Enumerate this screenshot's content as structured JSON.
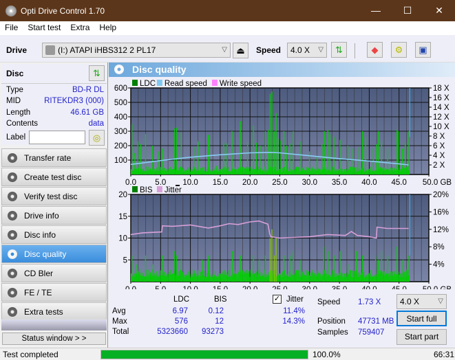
{
  "window": {
    "title": "Opti Drive Control 1.70",
    "minimize": "—",
    "maximize": "☐",
    "close": "✕"
  },
  "menu": [
    "File",
    "Start test",
    "Extra",
    "Help"
  ],
  "toolbar": {
    "drive_label": "Drive",
    "drive_value": "(I:)  ATAPI iHBS312   2 PL17",
    "speed_label": "Speed",
    "speed_value": "4.0 X",
    "eject": "⏏"
  },
  "disc": {
    "title": "Disc",
    "rows": [
      {
        "k": "Type",
        "v": "BD-R DL"
      },
      {
        "k": "MID",
        "v": "RITEKDR3 (000)"
      },
      {
        "k": "Length",
        "v": "46.61 GB"
      },
      {
        "k": "Contents",
        "v": "data"
      }
    ],
    "label_key": "Label",
    "label_value": ""
  },
  "nav": [
    "Transfer rate",
    "Create test disc",
    "Verify test disc",
    "Drive info",
    "Disc info",
    "Disc quality",
    "CD Bler",
    "FE / TE",
    "Extra tests"
  ],
  "nav_active": 5,
  "status_window": "Status window > >",
  "panel_title": "Disc quality",
  "chart_data": [
    {
      "type": "bar",
      "title": "",
      "legend": [
        "LDC",
        "Read speed",
        "Write speed"
      ],
      "colors": {
        "LDC": "#00c000",
        "Read speed": "#80c8f0",
        "Write speed": "#ff80ff"
      },
      "xlabel": "GB",
      "xlim": [
        0,
        50
      ],
      "xticks": [
        "0.0",
        "5.0",
        "10.0",
        "15.0",
        "20.0",
        "25.0",
        "30.0",
        "35.0",
        "40.0",
        "45.0",
        "50.0 GB"
      ],
      "ylim": [
        0,
        600
      ],
      "yticks": [
        "100",
        "200",
        "300",
        "400",
        "500",
        "600"
      ],
      "y2lim": [
        0,
        18
      ],
      "y2ticks": [
        "2 X",
        "4 X",
        "6 X",
        "8 X",
        "10 X",
        "12 X",
        "14 X",
        "16 X",
        "18 X"
      ],
      "ldc_peaks": [
        [
          0.1,
          350
        ],
        [
          0.6,
          150
        ],
        [
          1.1,
          230
        ],
        [
          1.6,
          210
        ],
        [
          2.4,
          280
        ],
        [
          3.6,
          200
        ],
        [
          4.5,
          160
        ],
        [
          5.3,
          180
        ],
        [
          7.3,
          320
        ],
        [
          7.6,
          325
        ],
        [
          8.4,
          290
        ],
        [
          10.5,
          190
        ],
        [
          11.2,
          230
        ],
        [
          12.9,
          275
        ],
        [
          13.1,
          270
        ],
        [
          14.3,
          60
        ],
        [
          15.5,
          220
        ],
        [
          16.1,
          215
        ],
        [
          16.9,
          300
        ],
        [
          18.3,
          370
        ],
        [
          19.5,
          225
        ],
        [
          20.5,
          340
        ],
        [
          21.0,
          220
        ],
        [
          21.6,
          200
        ],
        [
          22.5,
          300
        ],
        [
          23.0,
          310
        ],
        [
          23.3,
          560
        ],
        [
          23.6,
          575
        ],
        [
          24.0,
          300
        ],
        [
          24.3,
          425
        ],
        [
          24.6,
          250
        ],
        [
          25.1,
          235
        ],
        [
          25.6,
          300
        ],
        [
          26.1,
          200
        ],
        [
          26.6,
          215
        ],
        [
          27.2,
          300
        ],
        [
          28.5,
          230
        ],
        [
          29.9,
          160
        ],
        [
          31.2,
          120
        ],
        [
          32.0,
          210
        ],
        [
          32.4,
          300
        ],
        [
          33.0,
          310
        ],
        [
          33.3,
          280
        ],
        [
          34.0,
          260
        ],
        [
          35.0,
          240
        ],
        [
          36.3,
          200
        ],
        [
          37.0,
          180
        ],
        [
          38.0,
          190
        ],
        [
          38.8,
          300
        ],
        [
          39.3,
          260
        ],
        [
          40.6,
          180
        ],
        [
          41.2,
          210
        ],
        [
          41.5,
          300
        ],
        [
          42.0,
          230
        ],
        [
          43.0,
          180
        ],
        [
          44.6,
          310
        ],
        [
          44.8,
          300
        ],
        [
          45.5,
          180
        ],
        [
          46.0,
          220
        ],
        [
          46.6,
          300
        ]
      ],
      "read_speed": [
        [
          0,
          2.1
        ],
        [
          2,
          2.4
        ],
        [
          5,
          2.9
        ],
        [
          10,
          3.6
        ],
        [
          15,
          4.1
        ],
        [
          20,
          4.5
        ],
        [
          23.5,
          4.6
        ],
        [
          25,
          4.5
        ],
        [
          30,
          3.9
        ],
        [
          35,
          3.3
        ],
        [
          40,
          2.8
        ],
        [
          45,
          2.2
        ],
        [
          46.6,
          2.0
        ]
      ]
    },
    {
      "type": "bar",
      "title": "",
      "legend": [
        "BIS",
        "Jitter"
      ],
      "colors": {
        "BIS": "#00c000",
        "Jitter": "#d8a0d8"
      },
      "xlabel": "GB",
      "xlim": [
        0,
        50
      ],
      "xticks": [
        "0.0",
        "5.0",
        "10.0",
        "15.0",
        "20.0",
        "25.0",
        "30.0",
        "35.0",
        "40.0",
        "45.0",
        "50.0 GB"
      ],
      "ylim": [
        0,
        20
      ],
      "yticks": [
        "5",
        "10",
        "15",
        "20"
      ],
      "y2lim": [
        0,
        20
      ],
      "y2ticks": [
        "4%",
        "8%",
        "12%",
        "16%",
        "20%"
      ],
      "bis_peaks": [
        [
          0.1,
          6
        ],
        [
          0.8,
          4
        ],
        [
          1.4,
          3
        ],
        [
          2.4,
          6
        ],
        [
          3.7,
          4
        ],
        [
          5.3,
          6
        ],
        [
          7.3,
          7
        ],
        [
          7.6,
          6
        ],
        [
          8.4,
          5
        ],
        [
          11.9,
          5
        ],
        [
          12.9,
          6
        ],
        [
          13.1,
          5
        ],
        [
          16.5,
          4
        ],
        [
          17.0,
          7
        ],
        [
          18.3,
          6
        ],
        [
          20.5,
          6
        ],
        [
          21.5,
          5
        ],
        [
          22.5,
          6
        ],
        [
          23.3,
          10
        ],
        [
          23.6,
          12
        ],
        [
          24.0,
          6
        ],
        [
          24.3,
          10
        ],
        [
          25.6,
          6
        ],
        [
          26.6,
          6
        ],
        [
          27.2,
          7
        ],
        [
          28.5,
          5
        ],
        [
          32.3,
          8
        ],
        [
          33.0,
          7
        ],
        [
          34.0,
          6
        ],
        [
          35.0,
          7
        ],
        [
          36.3,
          4
        ],
        [
          37.8,
          7
        ],
        [
          38.8,
          6
        ],
        [
          41.0,
          6
        ],
        [
          41.5,
          5
        ],
        [
          42.0,
          7
        ],
        [
          43.0,
          6
        ],
        [
          44.6,
          8
        ],
        [
          45.6,
          5
        ],
        [
          46.6,
          6
        ]
      ],
      "jitter": [
        [
          0,
          10.8
        ],
        [
          2,
          11.2
        ],
        [
          5.2,
          11.4
        ],
        [
          5.3,
          12.8
        ],
        [
          7,
          12.7
        ],
        [
          10,
          13.0
        ],
        [
          13,
          12.3
        ],
        [
          15,
          12.8
        ],
        [
          16.5,
          13.3
        ],
        [
          18,
          13.1
        ],
        [
          20,
          13.7
        ],
        [
          21.5,
          13.9
        ],
        [
          23,
          13.2
        ],
        [
          23.3,
          11.0
        ],
        [
          23.5,
          10.3
        ],
        [
          25,
          10.0
        ],
        [
          30,
          10.3
        ],
        [
          33,
          10.8
        ],
        [
          36,
          10.6
        ],
        [
          37,
          11.5
        ],
        [
          38,
          10.6
        ],
        [
          40,
          10.3
        ],
        [
          41.2,
          10.0
        ],
        [
          41.3,
          12.5
        ],
        [
          43,
          12.2
        ],
        [
          46.6,
          12.2
        ]
      ]
    }
  ],
  "stats": {
    "hdr_ldc": "LDC",
    "hdr_bis": "BIS",
    "jitter_label": "Jitter",
    "jitter_checked": true,
    "rows": [
      {
        "k": "Avg",
        "ldc": "6.97",
        "bis": "0.12",
        "jit": "11.4%"
      },
      {
        "k": "Max",
        "ldc": "576",
        "bis": "12",
        "jit": "14.3%"
      },
      {
        "k": "Total",
        "ldc": "5323660",
        "bis": "93273",
        "jit": ""
      }
    ],
    "speed_label": "Speed",
    "speed_value": "1.73 X",
    "position_label": "Position",
    "position_value": "47731 MB",
    "samples_label": "Samples",
    "samples_value": "759407",
    "speed_select": "4.0 X",
    "start_full": "Start full",
    "start_part": "Start part"
  },
  "statusbar": {
    "text": "Test completed",
    "progress": 100,
    "progress_text": "100.0%",
    "time": "66:31"
  }
}
